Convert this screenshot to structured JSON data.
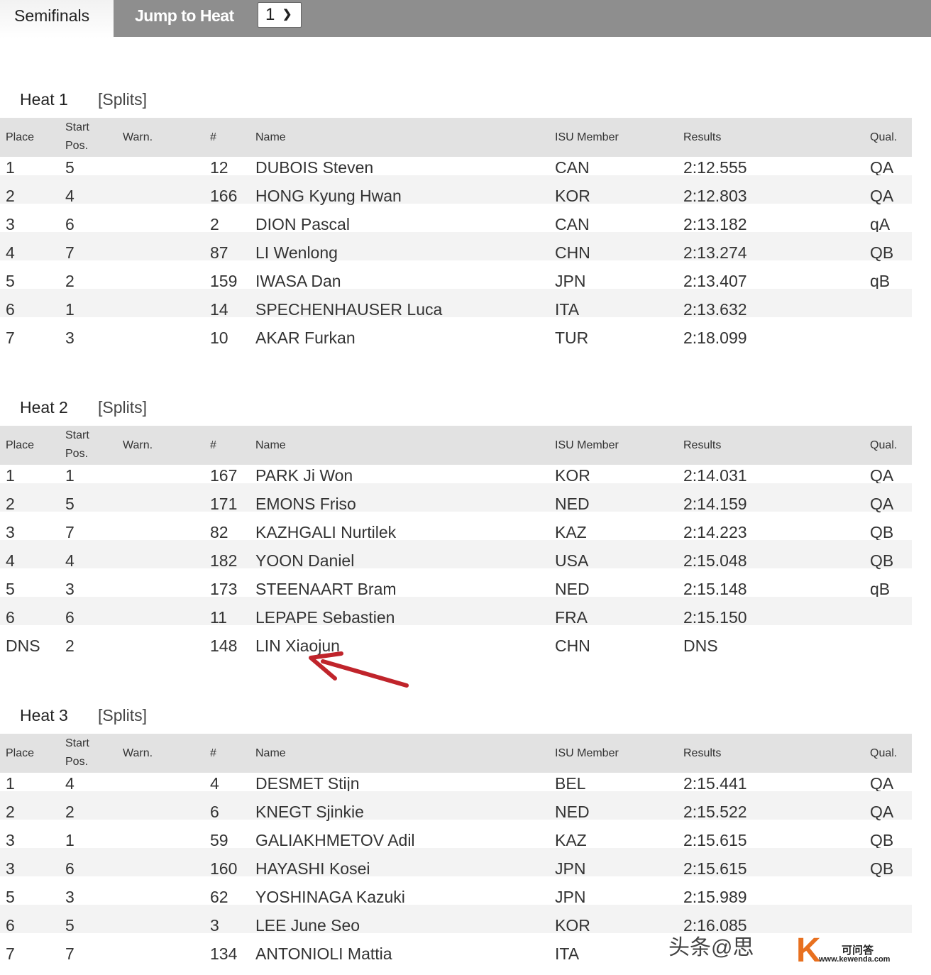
{
  "topbar": {
    "active_tab": "Semifinals",
    "jump_label": "Jump to Heat",
    "heat_select": "1"
  },
  "columns": [
    "Place",
    "Start Pos.",
    "Warn.",
    "#",
    "Name",
    "ISU Member",
    "Results",
    "Qual."
  ],
  "columns_split": {
    "start_1": "Start",
    "start_2": "Pos."
  },
  "splits_label": "[Splits]",
  "heats": [
    {
      "title": "Heat 1",
      "rows": [
        [
          "1",
          "5",
          "",
          "12",
          "DUBOIS Steven",
          "CAN",
          "2:12.555",
          "QA"
        ],
        [
          "2",
          "4",
          "",
          "166",
          "HONG Kyung Hwan",
          "KOR",
          "2:12.803",
          "QA"
        ],
        [
          "3",
          "6",
          "",
          "2",
          "DION Pascal",
          "CAN",
          "2:13.182",
          "qA"
        ],
        [
          "4",
          "7",
          "",
          "87",
          "LI Wenlong",
          "CHN",
          "2:13.274",
          "QB"
        ],
        [
          "5",
          "2",
          "",
          "159",
          "IWASA Dan",
          "JPN",
          "2:13.407",
          "qB"
        ],
        [
          "6",
          "1",
          "",
          "14",
          "SPECHENHAUSER Luca",
          "ITA",
          "2:13.632",
          ""
        ],
        [
          "7",
          "3",
          "",
          "10",
          "AKAR Furkan",
          "TUR",
          "2:18.099",
          ""
        ]
      ]
    },
    {
      "title": "Heat 2",
      "rows": [
        [
          "1",
          "1",
          "",
          "167",
          "PARK Ji Won",
          "KOR",
          "2:14.031",
          "QA"
        ],
        [
          "2",
          "5",
          "",
          "171",
          "EMONS Friso",
          "NED",
          "2:14.159",
          "QA"
        ],
        [
          "3",
          "7",
          "",
          "82",
          "KAZHGALI Nurtilek",
          "KAZ",
          "2:14.223",
          "QB"
        ],
        [
          "4",
          "4",
          "",
          "182",
          "YOON Daniel",
          "USA",
          "2:15.048",
          "QB"
        ],
        [
          "5",
          "3",
          "",
          "173",
          "STEENAART Bram",
          "NED",
          "2:15.148",
          "qB"
        ],
        [
          "6",
          "6",
          "",
          "11",
          "LEPAPE Sebastien",
          "FRA",
          "2:15.150",
          ""
        ],
        [
          "DNS",
          "2",
          "",
          "148",
          "LIN Xiaojun",
          "CHN",
          "DNS",
          ""
        ]
      ]
    },
    {
      "title": "Heat 3",
      "rows": [
        [
          "1",
          "4",
          "",
          "4",
          "DESMET Stijn",
          "BEL",
          "2:15.441",
          "QA"
        ],
        [
          "2",
          "2",
          "",
          "6",
          "KNEGT Sjinkie",
          "NED",
          "2:15.522",
          "QA"
        ],
        [
          "3",
          "1",
          "",
          "59",
          "GALIAKHMETOV Adil",
          "KAZ",
          "2:15.615",
          "QB"
        ],
        [
          "3",
          "6",
          "",
          "160",
          "HAYASHI Kosei",
          "JPN",
          "2:15.615",
          "QB"
        ],
        [
          "5",
          "3",
          "",
          "62",
          "YOSHINAGA Kazuki",
          "JPN",
          "2:15.989",
          ""
        ],
        [
          "6",
          "5",
          "",
          "3",
          "LEE June Seo",
          "KOR",
          "2:16.085",
          ""
        ],
        [
          "7",
          "7",
          "",
          "134",
          "ANTONIOLI Mattia",
          "ITA",
          "",
          " "
        ]
      ]
    }
  ],
  "watermark": {
    "text": "头条@思",
    "logo_text": "可问答",
    "logo_url_text": "www.kewenda.com"
  },
  "colors": {
    "topbar": "#8e8e8e",
    "header": "#e2e2e2",
    "stripe": "#f3f3f3",
    "arrow": "#c0242b",
    "logo": "#e8701f"
  }
}
